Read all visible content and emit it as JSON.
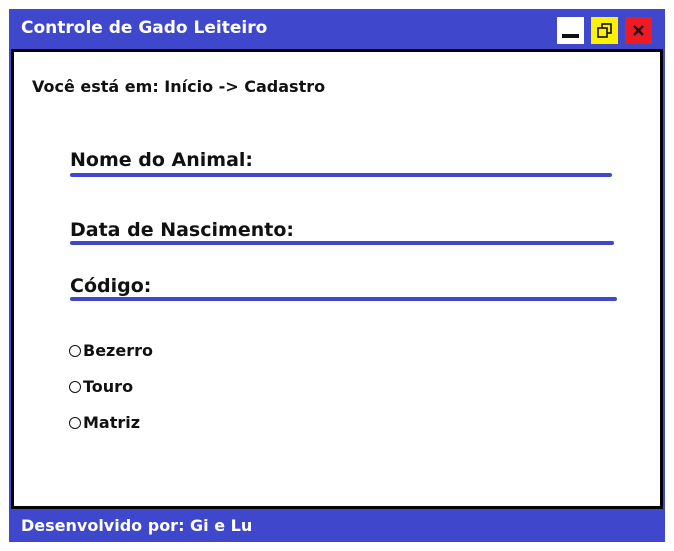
{
  "window": {
    "title": "Controle de Gado Leiteiro",
    "controls": {
      "minimize_icon": "minimize-icon",
      "maximize_icon": "restore-icon",
      "close_icon": "close-icon",
      "minimize_color": "#ffffff",
      "maximize_color": "#fff200",
      "close_color": "#ed1c24"
    },
    "accent_color": "#3f48cc"
  },
  "breadcrumb": "Você está em: Início -> Cadastro",
  "form": {
    "fields": [
      {
        "label": "Nome do Animal:",
        "value": ""
      },
      {
        "label": "Data de Nascimento:",
        "value": ""
      },
      {
        "label": "Código:",
        "value": ""
      }
    ],
    "radio_options": [
      {
        "label": "Bezerro",
        "checked": false
      },
      {
        "label": "Touro",
        "checked": false
      },
      {
        "label": "Matriz",
        "checked": false
      }
    ]
  },
  "footer": {
    "text": "Desenvolvido por: Gi e Lu"
  }
}
